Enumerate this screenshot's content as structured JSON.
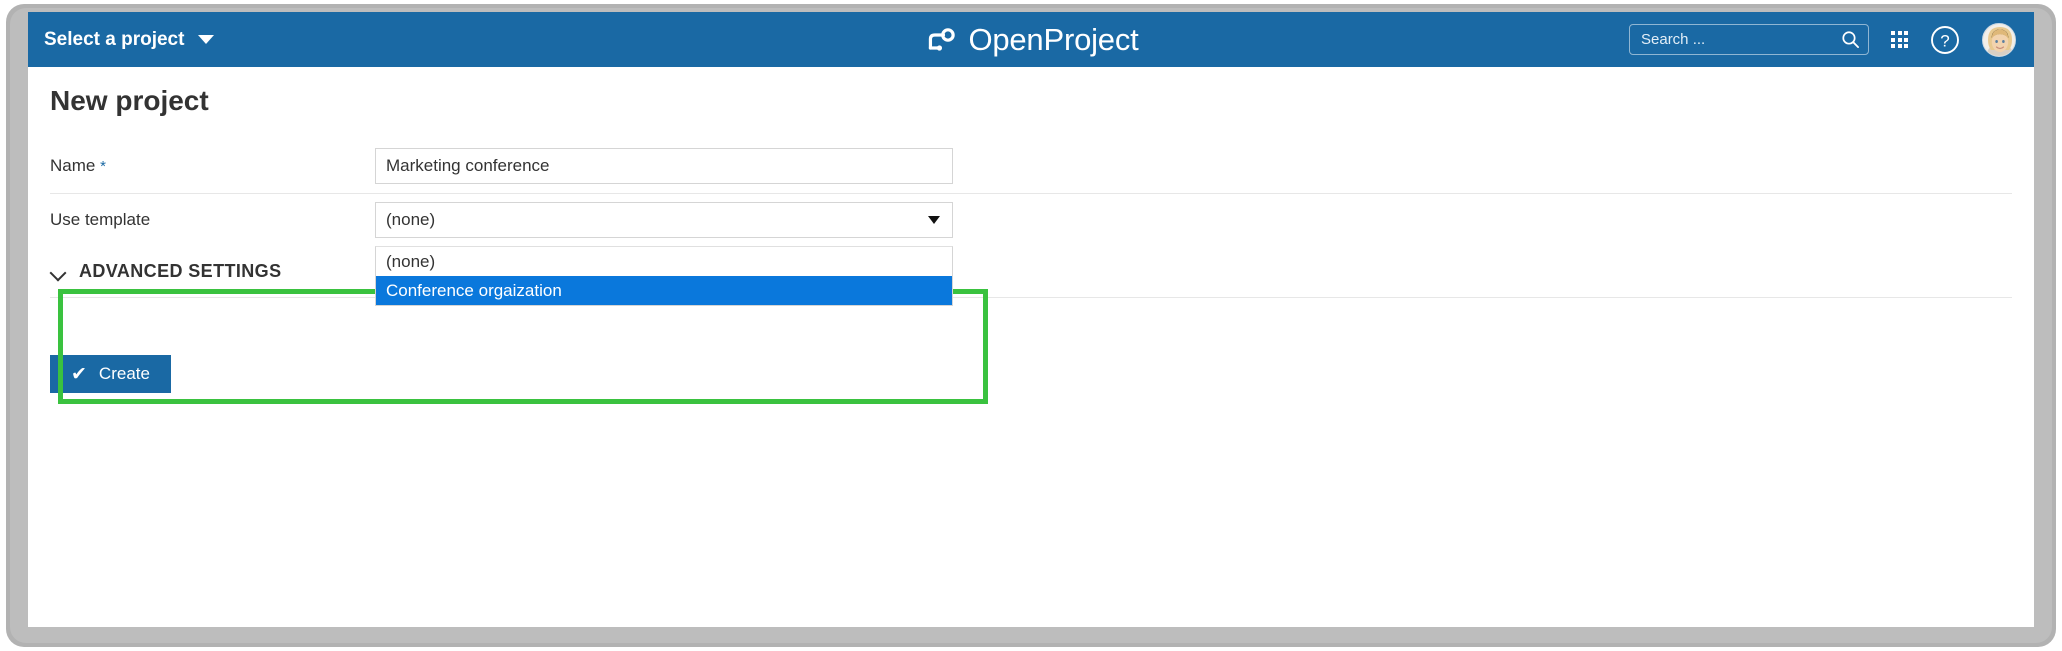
{
  "header": {
    "project_select_label": "Select a project",
    "brand_name": "OpenProject",
    "search_placeholder": "Search ...",
    "search_value": "",
    "icons": {
      "caret": "chevron-down-icon",
      "search": "search-icon",
      "modules": "grid-apps-icon",
      "help": "help-circle-icon",
      "avatar": "user-avatar"
    },
    "colors": {
      "bar_background": "#1a69a4",
      "text": "#ffffff"
    }
  },
  "main": {
    "page_title": "New project",
    "fields": [
      {
        "label": "Name",
        "required_marker": "*",
        "value": "Marketing conference",
        "type": "text"
      },
      {
        "label": "Use template",
        "required_marker": "",
        "value": "(none)",
        "type": "select"
      }
    ],
    "dropdown": {
      "open": true,
      "options": [
        {
          "label": "(none)",
          "selected": false
        },
        {
          "label": "Conference orgaization",
          "selected": true
        }
      ],
      "selected_color": "#0a78dc"
    },
    "advanced_settings": {
      "label": "ADVANCED SETTINGS",
      "chevron": "chevron-down-icon",
      "expanded": false
    },
    "create_button": {
      "label": "Create",
      "icon": "check-icon",
      "color": "#1a69a4"
    },
    "highlight": {
      "color": "#3ac23f",
      "description": "green-annotation-box"
    }
  }
}
